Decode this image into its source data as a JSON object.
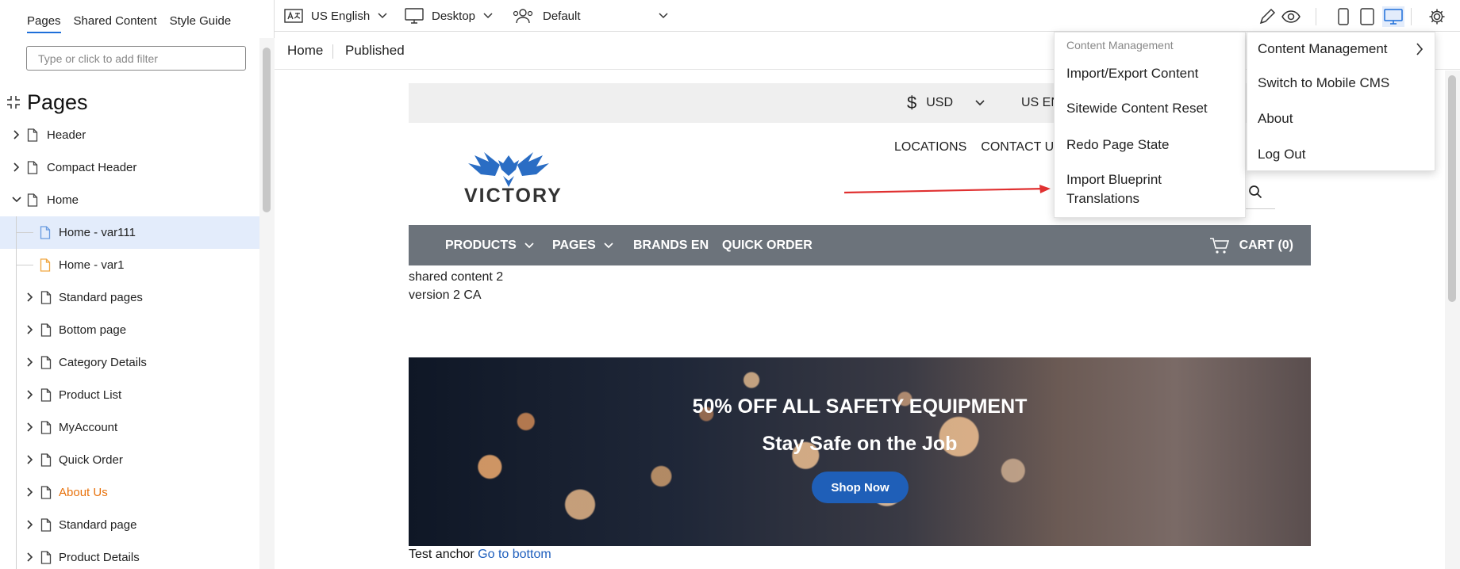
{
  "left_panel": {
    "tabs": [
      {
        "label": "Pages",
        "active": true
      },
      {
        "label": "Shared Content",
        "active": false
      },
      {
        "label": "Style Guide",
        "active": false
      }
    ],
    "filter": {
      "placeholder": "Type or click to add filter",
      "value": ""
    },
    "heading": "Pages",
    "tree": [
      {
        "label": "Header",
        "level": 0,
        "expandable": true,
        "expanded": false,
        "icon": "page-icon",
        "color": "default"
      },
      {
        "label": "Compact Header",
        "level": 0,
        "expandable": true,
        "expanded": false,
        "icon": "page-icon",
        "color": "default"
      },
      {
        "label": "Home",
        "level": 0,
        "expandable": true,
        "expanded": true,
        "icon": "page-icon",
        "color": "default"
      },
      {
        "label": "Home - var111",
        "level": 1,
        "expandable": false,
        "icon": "page-variant-icon",
        "color": "blue",
        "selected": true
      },
      {
        "label": "Home - var1",
        "level": 1,
        "expandable": false,
        "icon": "page-variant-icon",
        "color": "orange"
      },
      {
        "label": "Standard pages",
        "level": 1,
        "expandable": true,
        "expanded": false,
        "icon": "page-icon",
        "color": "default"
      },
      {
        "label": "Bottom page",
        "level": 1,
        "expandable": true,
        "expanded": false,
        "icon": "page-icon",
        "color": "default"
      },
      {
        "label": "Category Details",
        "level": 1,
        "expandable": true,
        "expanded": false,
        "icon": "page-icon",
        "color": "default"
      },
      {
        "label": "Product List",
        "level": 1,
        "expandable": true,
        "expanded": false,
        "icon": "page-icon",
        "color": "default"
      },
      {
        "label": "MyAccount",
        "level": 1,
        "expandable": true,
        "expanded": false,
        "icon": "page-icon",
        "color": "default"
      },
      {
        "label": "Quick Order",
        "level": 1,
        "expandable": true,
        "expanded": false,
        "icon": "page-icon",
        "color": "default"
      },
      {
        "label": "About Us",
        "level": 1,
        "expandable": true,
        "expanded": false,
        "icon": "page-icon",
        "color": "orange"
      },
      {
        "label": "Standard page",
        "level": 1,
        "expandable": true,
        "expanded": false,
        "icon": "page-icon",
        "color": "default"
      },
      {
        "label": "Product Details",
        "level": 1,
        "expandable": true,
        "expanded": false,
        "icon": "page-icon",
        "color": "default"
      }
    ]
  },
  "toolbar": {
    "language": "US English",
    "device": "Desktop",
    "persona": "Default",
    "icons": [
      "edit-pencil-icon",
      "preview-eye-icon",
      "phone-icon",
      "tablet-icon",
      "desktop-icon",
      "settings-gear-icon"
    ]
  },
  "breadcrumb": {
    "page": "Home",
    "status": "Published"
  },
  "preview": {
    "currency_symbol": "$",
    "currency": "USD",
    "language_short": "US EN",
    "logo_text": "VICTORY",
    "header_links": [
      "LOCATIONS",
      "CONTACT US"
    ],
    "nav": [
      {
        "label": "PRODUCTS",
        "dropdown": true
      },
      {
        "label": "PAGES",
        "dropdown": true
      },
      {
        "label": "BRANDS EN",
        "dropdown": false
      },
      {
        "label": "QUICK ORDER",
        "dropdown": false
      }
    ],
    "cart": "CART (0)",
    "shared_lines": [
      "shared content 2",
      "version 2 CA"
    ],
    "hero": {
      "title": "50% OFF ALL SAFETY EQUIPMENT",
      "subtitle": "Stay Safe on the Job",
      "button": "Shop Now"
    },
    "anchor": {
      "text": "Test anchor",
      "link": "Go to bottom"
    }
  },
  "menu": {
    "items": [
      "Content Management",
      "Switch to Mobile CMS",
      "About",
      "Log Out"
    ]
  },
  "submenu": {
    "header": "Content Management",
    "items": [
      "Import/Export Content",
      "Sitewide Content Reset",
      "Redo Page State",
      "Import Blueprint Translations"
    ]
  },
  "colors": {
    "accent": "#1e6fd9",
    "selected_row": "#e3ecfb",
    "orange": "#e8720c",
    "nav_bar": "#6c737b",
    "hero_button": "#1f5fb8",
    "arrow": "#e03030"
  }
}
